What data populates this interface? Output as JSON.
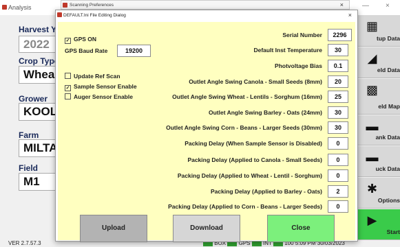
{
  "background": {
    "title": "Analysis",
    "controls": [
      "—",
      "×"
    ],
    "fields": [
      {
        "label": "Harvest Ye",
        "value": "2022"
      },
      {
        "label": "Crop Type",
        "value": "Whea"
      },
      {
        "label": "Grower",
        "value": "KOOL"
      },
      {
        "label": "Farm",
        "value": "MILTA"
      },
      {
        "label": "Field",
        "value": "M1"
      }
    ],
    "side_buttons": [
      {
        "label": "tup Data",
        "icon": "▦"
      },
      {
        "label": "eld Data",
        "icon": "◢"
      },
      {
        "label": "eld Map",
        "icon": "▩"
      },
      {
        "label": "ank Data",
        "icon": "▬"
      },
      {
        "label": "uck Data",
        "icon": "▬"
      },
      {
        "label": "Options",
        "icon": "✱"
      },
      {
        "label": "Start",
        "icon": "▶"
      }
    ],
    "status": {
      "version": "VER 2.7.57.3",
      "items": [
        "BOX",
        "GPS",
        "INT",
        "100"
      ],
      "datetime": "5:09 PM 30/03/2023"
    }
  },
  "prefs_window": {
    "title": "Scanning Preferences",
    "close": "×"
  },
  "dialog": {
    "title": "DEFAULT.Ini File Editing Dialog",
    "close": "×",
    "gps_on": {
      "label": "GPS ON",
      "checked": true
    },
    "gps_baud": {
      "label": "GPS Baud Rate",
      "value": "19200"
    },
    "update_ref": {
      "label": "Update Ref Scan",
      "checked": false
    },
    "sample_sensor": {
      "label": "Sample Sensor Enable",
      "checked": true
    },
    "auger_sensor": {
      "label": "Auger Sensor Enable",
      "checked": false
    },
    "params": [
      {
        "label": "Serial Number",
        "value": "2296"
      },
      {
        "label": "Default Inst Temperature",
        "value": "30"
      },
      {
        "label": "Photvoltage Bias",
        "value": "0.1"
      },
      {
        "label": "Outlet Angle Swing Canola - Small Seeds (8mm)",
        "value": "20"
      },
      {
        "label": "Outlet Angle Swing Wheat - Lentils - Sorghum (16mm)",
        "value": "25"
      },
      {
        "label": "Outlet Angle Swing Barley - Oats (24mm)",
        "value": "30"
      },
      {
        "label": "Outlet Angle Swing Corn - Beans - Larger Seeds (30mm)",
        "value": "30"
      },
      {
        "label": "Packing Delay (When Sample Sensor is Disabled)",
        "value": "0"
      },
      {
        "label": "Packing Delay (Applied to Canola - Small Seeds)",
        "value": "0"
      },
      {
        "label": "Packing Delay (Applied to Wheat - Lentil - Sorghum)",
        "value": "0"
      },
      {
        "label": "Packing Delay (Applied to Barley - Oats)",
        "value": "2"
      },
      {
        "label": "Packing Delay (Applied to Corn - Beans - Larger Seeds)",
        "value": "0"
      }
    ],
    "buttons": {
      "upload": "Upload",
      "download": "Download",
      "close": "Close"
    },
    "colors": {
      "panel": "#ffffc0",
      "upload": "#b3b3b3",
      "download": "#d6d6d6",
      "close": "#7cf07c"
    }
  }
}
